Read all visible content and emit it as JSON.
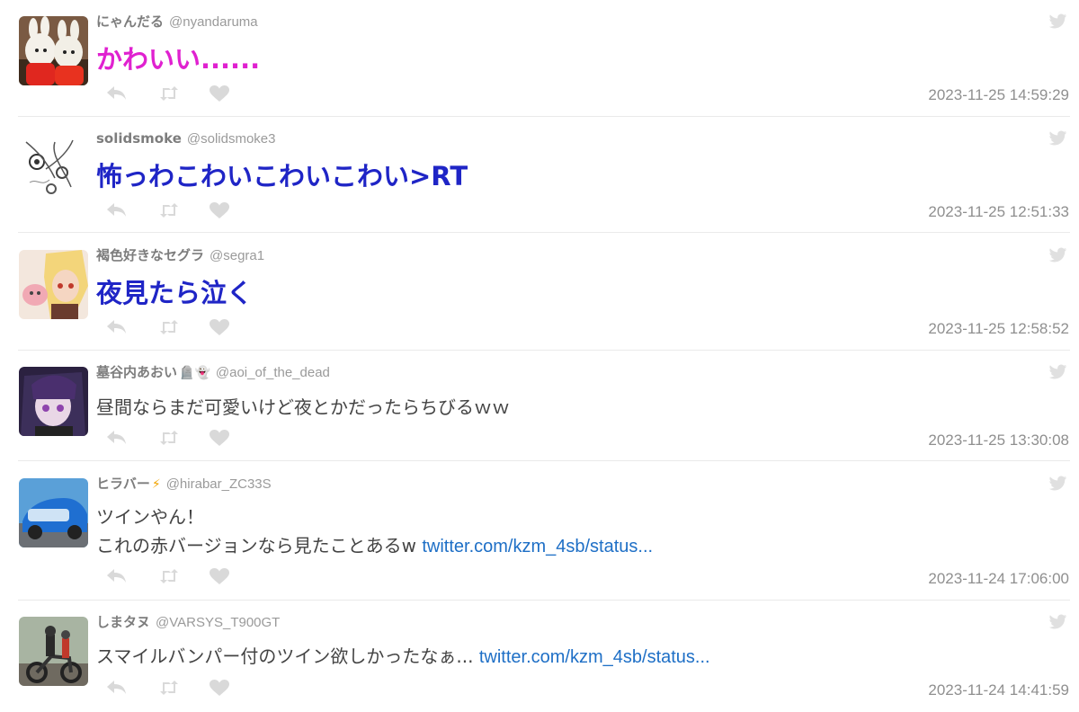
{
  "colors": {
    "pink_text": "#e021d0",
    "blue_text": "#1f25c6",
    "link": "#1e6fc6",
    "muted": "#8f8f8f"
  },
  "icons": [
    "reply-icon",
    "retweet-icon",
    "like-icon",
    "twitter-bird-icon"
  ],
  "tweets": [
    {
      "name": "にゃんだる",
      "handle": "@nyandaruma",
      "text": "かわいい......",
      "time": "2023-11-25 14:59:29"
    },
    {
      "name": "solidsmoke",
      "handle": "@solidsmoke3",
      "text": "怖っわこわいこわいこわい>RT",
      "time": "2023-11-25 12:51:33"
    },
    {
      "name": "褐色好きなセグラ",
      "handle": "@segra1",
      "text": "夜見たら泣く",
      "time": "2023-11-25 12:58:52"
    },
    {
      "name": "墓谷内あおい",
      "name_emoji": "🪦👻",
      "handle": "@aoi_of_the_dead",
      "text": "昼間ならまだ可愛いけど夜とかだったらちびるｗｗ",
      "time": "2023-11-25 13:30:08"
    },
    {
      "name": "ヒラバー",
      "name_emoji": "⚡",
      "handle": "@hirabar_ZC33S",
      "text_line1": "ツインやん！",
      "text_line2": "これの赤バージョンなら見たことあるw ",
      "link": "twitter.com/kzm_4sb/status...",
      "time": "2023-11-24 17:06:00"
    },
    {
      "name": "しまタヌ",
      "handle": "@VARSYS_T900GT",
      "text": "スマイルバンパー付のツイン欲しかったなぁ... ",
      "link": "twitter.com/kzm_4sb/status...",
      "time": "2023-11-24 14:41:59"
    }
  ]
}
